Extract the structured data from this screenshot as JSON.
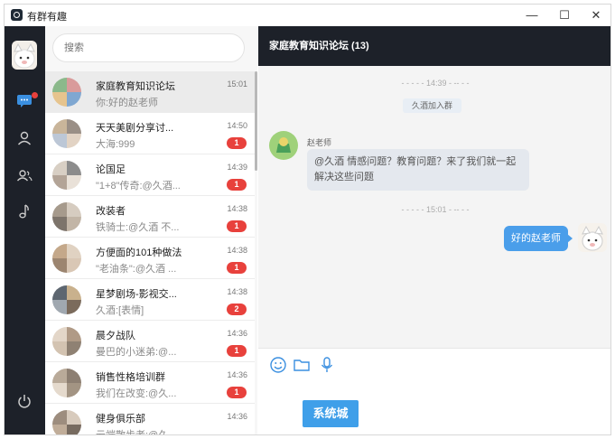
{
  "app": {
    "title": "有群有趣",
    "controls": {
      "minimize": "—",
      "maximize": "☐",
      "close": "✕"
    }
  },
  "nav": {
    "icons": [
      "chat-icon",
      "contacts-icon",
      "groups-icon",
      "music-icon",
      "power-icon"
    ],
    "active": "chat-icon",
    "unread_dot_color": "#e8413c"
  },
  "search": {
    "placeholder": "搜索",
    "value": ""
  },
  "chats": [
    {
      "name": "家庭教育知识论坛",
      "preview": "你:好的赵老师",
      "time": "15:01",
      "badge": ""
    },
    {
      "name": "天天美剧分享讨...",
      "preview": "大海:999",
      "time": "14:50",
      "badge": "1"
    },
    {
      "name": "论国足",
      "preview": "\"1+8\"传奇:@久酒...",
      "time": "14:39",
      "badge": "1"
    },
    {
      "name": "改装者",
      "preview": "铁骑士:@久酒 不...",
      "time": "14:38",
      "badge": "1"
    },
    {
      "name": "方便面的101种做法",
      "preview": "\"老油条\":@久酒 ...",
      "time": "14:38",
      "badge": "1"
    },
    {
      "name": "星梦剧场-影视交...",
      "preview": "久酒:[表情]",
      "time": "14:38",
      "badge": "2"
    },
    {
      "name": "晨夕战队",
      "preview": "曼巴的小迷弟:@...",
      "time": "14:36",
      "badge": "1"
    },
    {
      "name": "销售性格培训群",
      "preview": "我们在改变:@久...",
      "time": "14:36",
      "badge": "1"
    },
    {
      "name": "健身俱乐部",
      "preview": "云端散步者:@久...",
      "time": "14:36",
      "badge": ""
    }
  ],
  "conversation": {
    "title": "家庭教育知识论坛 (13)",
    "time_sep_1": "- - - - - 14:39 - -- - -",
    "join_notice": "久酒加入群",
    "sender_name": "赵老师",
    "incoming_text": "@久酒 情感问题？教育问题？来了我们就一起解决这些问题",
    "time_sep_2": "- - - - - 15:01 - -- - -",
    "outgoing_text": "好的赵老师"
  },
  "composer": {
    "tools": [
      "emoji-icon",
      "folder-icon",
      "microphone-icon"
    ]
  },
  "watermark": {
    "text": "系统城"
  },
  "colors": {
    "nav_bg": "#1d2129",
    "accent": "#4a9eea",
    "badge": "#e8413c"
  }
}
